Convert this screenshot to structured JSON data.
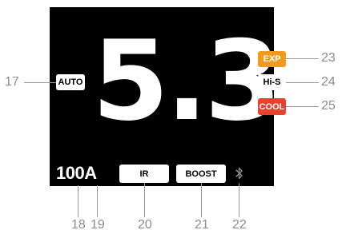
{
  "display": {
    "main_value": "5.3",
    "current_value": "100",
    "current_unit": "A"
  },
  "indicators": {
    "auto": "AUTO",
    "exp": "EXP",
    "hi_s": "Hi-S",
    "cool": "COOL",
    "ir": "IR",
    "boost": "BOOST"
  },
  "icons": {
    "connectivity": "bluetooth-icon"
  },
  "colors": {
    "screen_background": "#000000",
    "exp_badge": "#f39a1e",
    "cool_badge": "#e8412d",
    "neutral_badge": "#ffffff",
    "callout_text": "#8c8c8c"
  },
  "callouts": {
    "auto": "17",
    "current_value": "18",
    "current_unit": "19",
    "ir": "20",
    "boost": "21",
    "bluetooth": "22",
    "exp": "23",
    "hi_s": "24",
    "cool": "25"
  }
}
